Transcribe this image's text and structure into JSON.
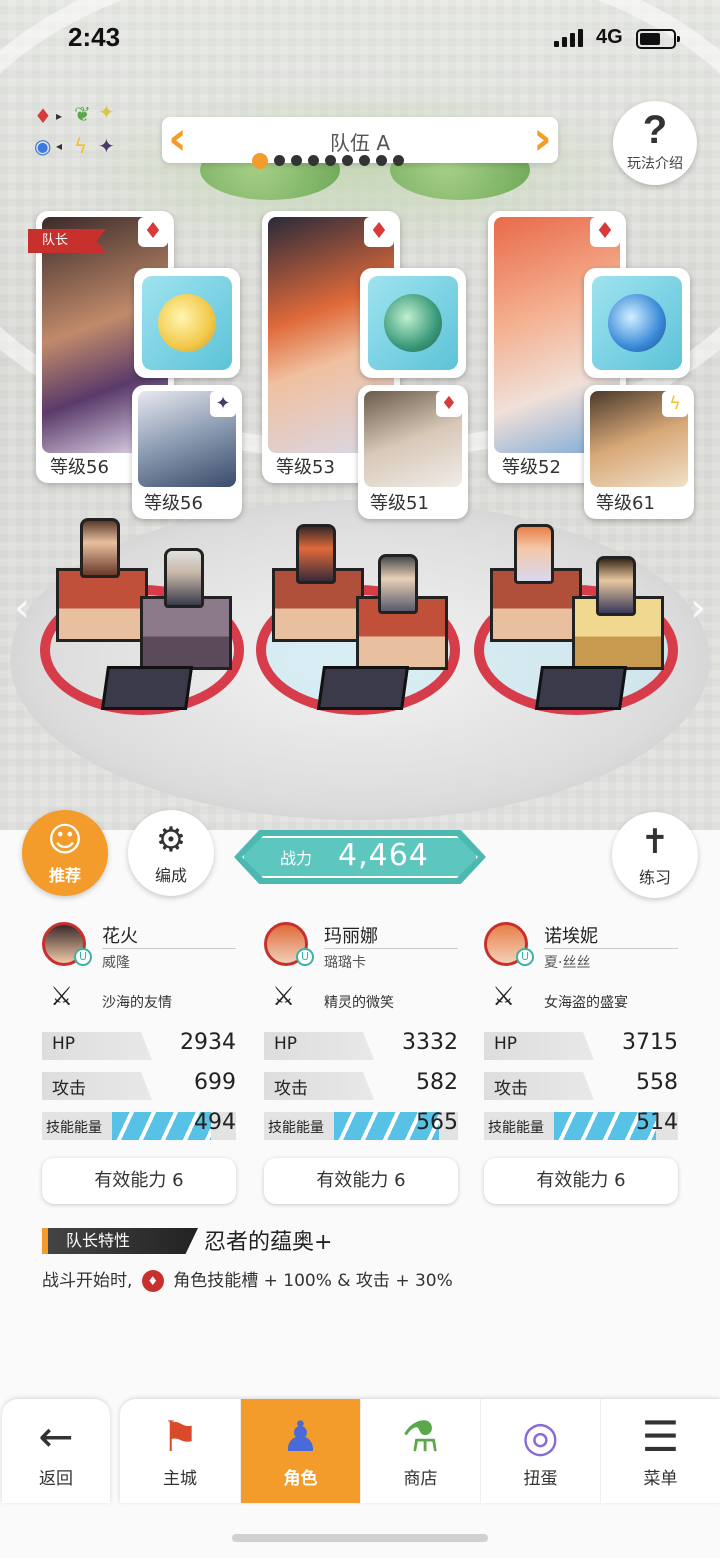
{
  "status_bar": {
    "time": "2:43",
    "network": "4G"
  },
  "team": {
    "title": "队伍 A",
    "page_count": 9,
    "active_page": 1
  },
  "help": {
    "label": "玩法介绍"
  },
  "leader_flag": "队长",
  "heroes": [
    {
      "level": "等级56",
      "gem_color": "red",
      "sub_level": "等级56",
      "sub_gem_color": "purple"
    },
    {
      "level": "等级53",
      "gem_color": "red",
      "sub_level": "等级51",
      "sub_gem_color": "red"
    },
    {
      "level": "等级52",
      "gem_color": "red",
      "sub_level": "等级61",
      "sub_gem_color": "yellow"
    }
  ],
  "buttons": {
    "recommend": "推荐",
    "formation": "编成",
    "practice": "练习"
  },
  "power": {
    "label": "战力",
    "value": "4,464"
  },
  "columns": [
    {
      "name": "花火",
      "sub": "威隆",
      "treasure": "沙海的友情",
      "hp": "2934",
      "atk": "699",
      "energy": "494",
      "energy_fill": 0.8,
      "effective": "有效能力 6"
    },
    {
      "name": "玛丽娜",
      "sub": "璐璐卡",
      "treasure": "精灵的微笑",
      "hp": "3332",
      "atk": "582",
      "energy": "565",
      "energy_fill": 0.85,
      "effective": "有效能力 6"
    },
    {
      "name": "诺埃妮",
      "sub": "夏·丝丝",
      "treasure": "女海盗的盛宴",
      "hp": "3715",
      "atk": "558",
      "energy": "514",
      "energy_fill": 0.82,
      "effective": "有效能力 6"
    }
  ],
  "stat_labels": {
    "hp": "HP",
    "atk": "攻击",
    "energy": "技能能量"
  },
  "leader_trait": {
    "label": "队长特性",
    "name": "忍者的蕴奥+",
    "desc_prefix": "战斗开始时,",
    "desc_rest": "角色技能槽 + 100% & 攻击 + 30%"
  },
  "nav": {
    "back": "返回",
    "tabs": [
      "主城",
      "角色",
      "商店",
      "扭蛋",
      "菜单"
    ],
    "active": "角色"
  },
  "colors": {
    "accent": "#f39c2b",
    "teal": "#4db8b0",
    "red": "#c8302e",
    "energy": "#58c1e6"
  }
}
